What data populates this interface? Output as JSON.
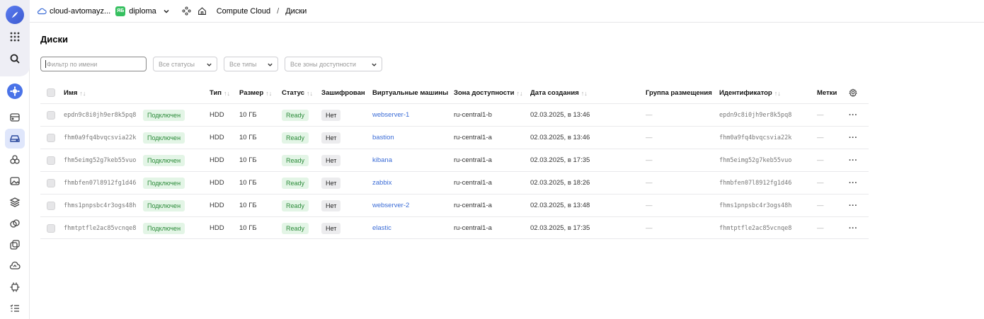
{
  "header": {
    "cloud_name": "cloud-avtomayz...",
    "folder_badge": "ЯБ",
    "folder_name": "diploma",
    "service": "Compute Cloud",
    "separator": "/",
    "current": "Диски"
  },
  "page": {
    "title": "Диски"
  },
  "filters": {
    "name_placeholder": "Фильтр по имени",
    "status_label": "Все статусы",
    "type_label": "Все типы",
    "zone_label": "Все зоны доступности"
  },
  "table": {
    "columns": {
      "name": "Имя",
      "type": "Тип",
      "size": "Размер",
      "status": "Статус",
      "encrypted": "Зашифрован",
      "vms": "Виртуальные машины",
      "zone": "Зона доступности",
      "created": "Дата создания",
      "placement": "Группа размещения",
      "id": "Идентификатор",
      "labels": "Метки"
    },
    "sort_glyph": "↑↓",
    "rows": [
      {
        "name": "epdn9c8i0jh9er8k5pq8",
        "attach": "Подключен",
        "type": "HDD",
        "size": "10 ГБ",
        "status": "Ready",
        "encrypted": "Нет",
        "vm": "webserver-1",
        "zone": "ru-central1-b",
        "created": "02.03.2025, в 13:46",
        "placement": "—",
        "id": "epdn9c8i0jh9er8k5pq8",
        "labels": "—"
      },
      {
        "name": "fhm0a9fq4bvqcsvia22k",
        "attach": "Подключен",
        "type": "HDD",
        "size": "10 ГБ",
        "status": "Ready",
        "encrypted": "Нет",
        "vm": "bastion",
        "zone": "ru-central1-a",
        "created": "02.03.2025, в 13:46",
        "placement": "—",
        "id": "fhm0a9fq4bvqcsvia22k",
        "labels": "—"
      },
      {
        "name": "fhm5eimg52g7keb55vuo",
        "attach": "Подключен",
        "type": "HDD",
        "size": "10 ГБ",
        "status": "Ready",
        "encrypted": "Нет",
        "vm": "kibana",
        "zone": "ru-central1-a",
        "created": "02.03.2025, в 17:35",
        "placement": "—",
        "id": "fhm5eimg52g7keb55vuo",
        "labels": "—"
      },
      {
        "name": "fhmbfen07l8912fg1d46",
        "attach": "Подключен",
        "type": "HDD",
        "size": "10 ГБ",
        "status": "Ready",
        "encrypted": "Нет",
        "vm": "zabbix",
        "zone": "ru-central1-a",
        "created": "02.03.2025, в 18:26",
        "placement": "—",
        "id": "fhmbfen07l8912fg1d46",
        "labels": "—"
      },
      {
        "name": "fhms1pnpsbc4r3ogs48h",
        "attach": "Подключен",
        "type": "HDD",
        "size": "10 ГБ",
        "status": "Ready",
        "encrypted": "Нет",
        "vm": "webserver-2",
        "zone": "ru-central1-a",
        "created": "02.03.2025, в 13:48",
        "placement": "—",
        "id": "fhms1pnpsbc4r3ogs48h",
        "labels": "—"
      },
      {
        "name": "fhmtptfle2ac85vcnqe8",
        "attach": "Подключен",
        "type": "HDD",
        "size": "10 ГБ",
        "status": "Ready",
        "encrypted": "Нет",
        "vm": "elastic",
        "zone": "ru-central1-a",
        "created": "02.03.2025, в 17:35",
        "placement": "—",
        "id": "fhmtptfle2ac85vcnqe8",
        "labels": "—"
      }
    ],
    "more_glyph": "···"
  },
  "colors": {
    "accent": "#3b6cd6",
    "ready_bg": "#e3f5e6",
    "ready_fg": "#2c8b3a",
    "folder_badge": "#36c060"
  }
}
